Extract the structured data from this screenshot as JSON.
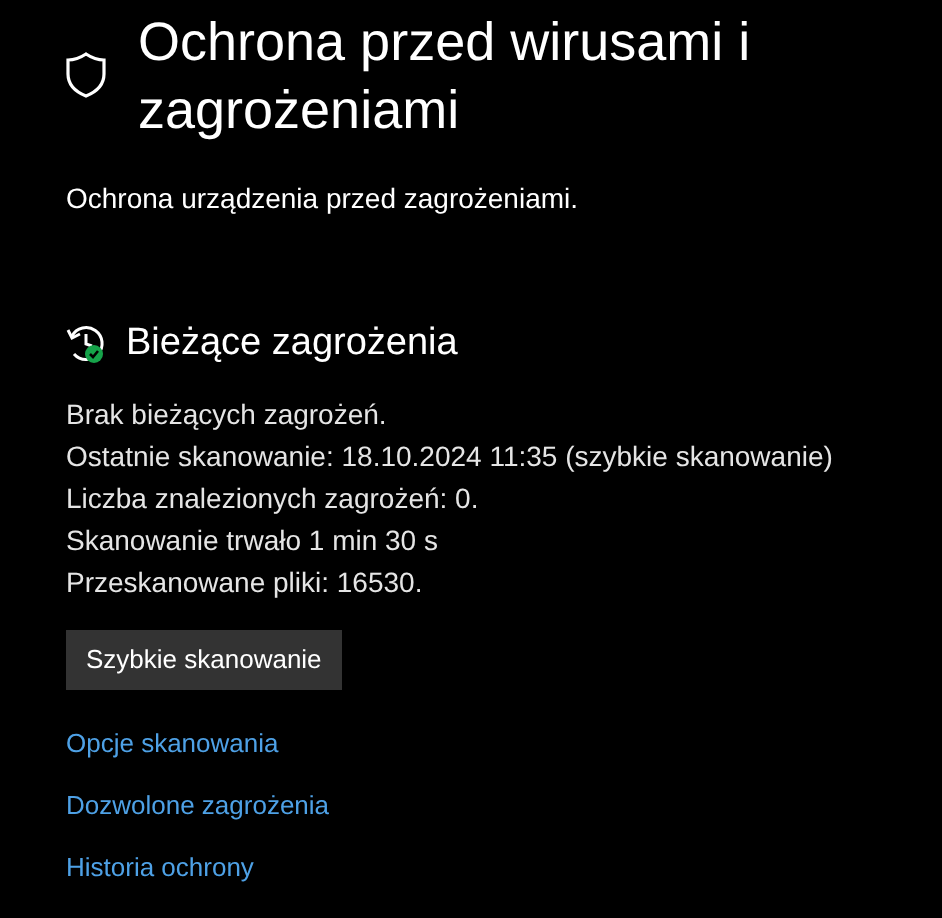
{
  "header": {
    "title": "Ochrona przed wirusami i zagrożeniami",
    "subtitle": "Ochrona urządzenia przed zagrożeniami."
  },
  "section": {
    "title": "Bieżące zagrożenia",
    "lines": [
      "Brak bieżących zagrożeń.",
      "Ostatnie skanowanie: 18.10.2024 11:35 (szybkie skanowanie)",
      "Liczba znalezionych zagrożeń: 0.",
      "Skanowanie trwało 1 min 30 s",
      "Przeskanowane pliki: 16530."
    ],
    "button": "Szybkie skanowanie"
  },
  "links": [
    "Opcje skanowania",
    "Dozwolone zagrożenia",
    "Historia ochrony"
  ]
}
